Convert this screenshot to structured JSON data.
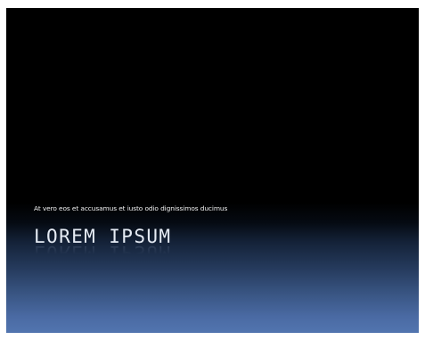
{
  "slide": {
    "subtitle": "At vero eos et accusamus et iusto odio dignissimos ducimus",
    "title": "LOREM IPSUM",
    "colors": {
      "background_top": "#000000",
      "background_bottom": "#5275af",
      "text": "#e6ecf5"
    }
  }
}
